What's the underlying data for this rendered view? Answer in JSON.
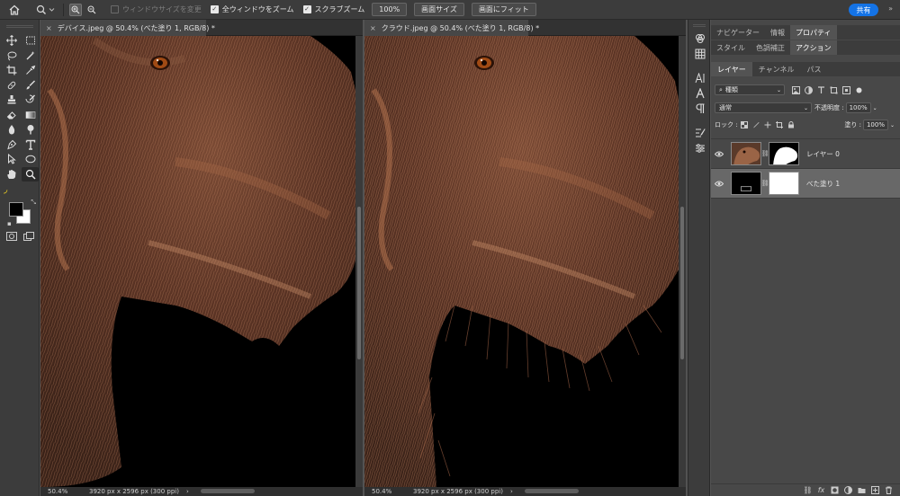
{
  "options_bar": {
    "resize_windows_label": "ウィンドウサイズを変更",
    "zoom_all_windows_label": "全ウィンドウをズーム",
    "scrubby_zoom_label": "スクラブズーム",
    "zoom_value": "100%",
    "fit_screen_size_label": "画面サイズ",
    "fit_screen_label": "画面にフィット",
    "share_label": "共有"
  },
  "documents": [
    {
      "tab_title": "デバイス.jpeg @ 50.4% (べた塗り 1, RGB/8) *",
      "zoom": "50.4%",
      "dimensions": "3920 px x 2596 px (300 ppi)"
    },
    {
      "tab_title": "クラウド.jpeg @ 50.4% (べた塗り 1, RGB/8) *",
      "zoom": "50.4%",
      "dimensions": "3920 px x 2596 px (300 ppi)"
    }
  ],
  "panels": {
    "row1_tabs": [
      "ナビゲーター",
      "情報",
      "プロパティ"
    ],
    "row2_tabs": [
      "スタイル",
      "色調補正",
      "アクション"
    ],
    "layers_tabs": [
      "レイヤー",
      "チャンネル",
      "パス"
    ],
    "filter_kind": "種類",
    "blend_mode": "通常",
    "opacity_label": "不透明度 :",
    "opacity_value": "100%",
    "lock_label": "ロック :",
    "fill_label": "塗り :",
    "fill_value": "100%"
  },
  "layers": [
    {
      "name": "レイヤー 0"
    },
    {
      "name": "べた塗り 1"
    }
  ],
  "colors": {
    "accent": "#1473e6",
    "foreground": "#000000",
    "background": "#ffffff"
  }
}
